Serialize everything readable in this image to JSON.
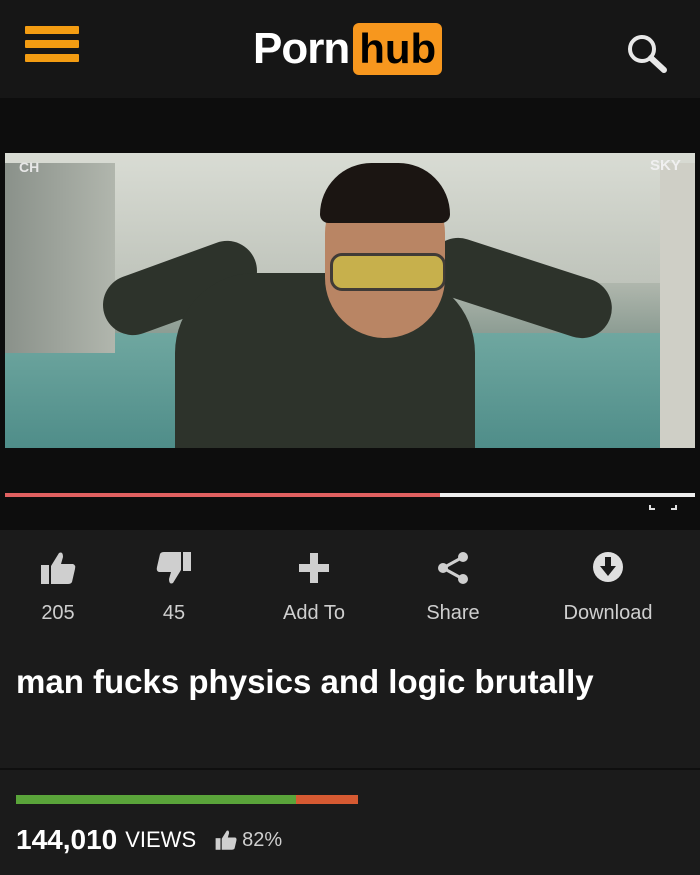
{
  "header": {
    "logo_part1": "Porn",
    "logo_part2": "hub",
    "accent_color": "#f7971e"
  },
  "player": {
    "watermark_left": "CH",
    "watermark_right": "SKY",
    "progress_fraction": 0.63
  },
  "actions": {
    "like_count": "205",
    "dislike_count": "45",
    "add_to_label": "Add To",
    "share_label": "Share",
    "download_label": "Download"
  },
  "video": {
    "title": "man fucks physics and logic brutally",
    "views_count": "144,010",
    "views_label": "VIEWS",
    "rating_percent_text": "82%",
    "rating_fraction": 0.82
  },
  "icons": [
    "menu-icon",
    "search-icon",
    "thumbs-up-icon",
    "thumbs-down-icon",
    "plus-icon",
    "share-icon",
    "download-icon",
    "fullscreen-icon"
  ]
}
